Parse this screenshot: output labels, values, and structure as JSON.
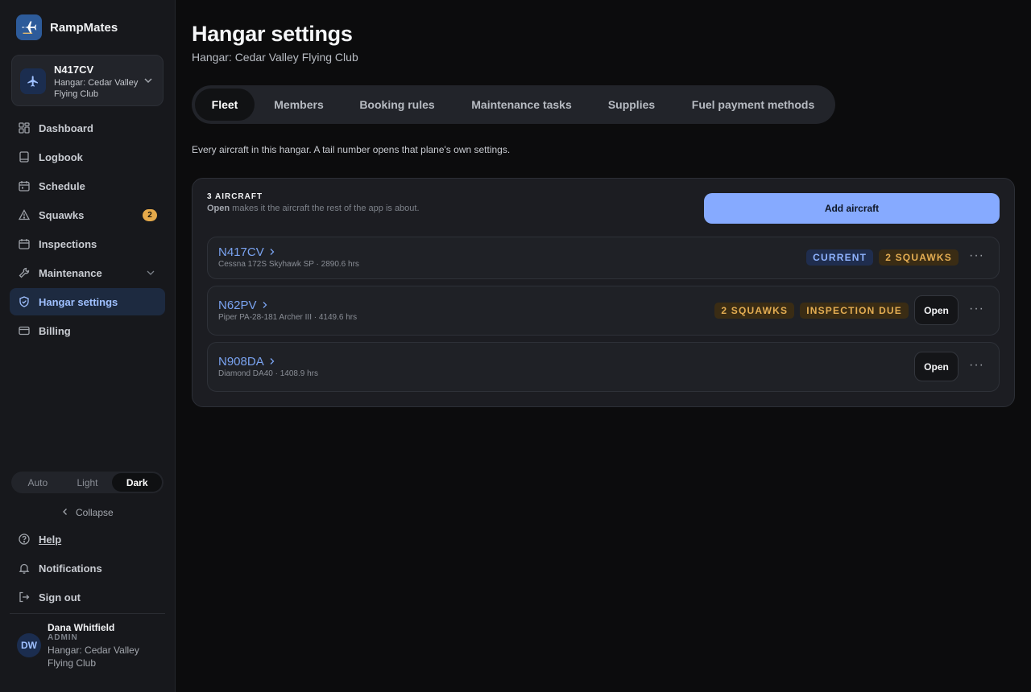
{
  "brand": {
    "name": "RampMates"
  },
  "account": {
    "tail": "N417CV",
    "hangar": "Hangar: Cedar Valley Flying Club"
  },
  "nav": {
    "items": [
      {
        "label": "Dashboard",
        "icon": "dashboard-icon"
      },
      {
        "label": "Logbook",
        "icon": "book-icon"
      },
      {
        "label": "Schedule",
        "icon": "calendar-icon"
      },
      {
        "label": "Squawks",
        "icon": "warning-icon",
        "badge": "2"
      },
      {
        "label": "Inspections",
        "icon": "calendar-check-icon"
      },
      {
        "label": "Maintenance",
        "icon": "wrench-icon"
      },
      {
        "label": "Hangar settings",
        "icon": "shield-icon",
        "active": true
      },
      {
        "label": "Billing",
        "icon": "card-icon"
      }
    ]
  },
  "theme": {
    "options": [
      "Auto",
      "Light",
      "Dark"
    ],
    "selected": "Dark"
  },
  "sidebar_footer": {
    "collapse": "Collapse",
    "help": "Help",
    "notifications": "Notifications",
    "signout": "Sign out"
  },
  "user": {
    "initials": "DW",
    "name": "Dana Whitfield",
    "role": "ADMIN",
    "hangar": "Hangar: Cedar Valley Flying Club"
  },
  "page": {
    "title": "Hangar settings",
    "subtitle": "Hangar: Cedar Valley Flying Club",
    "description": "Every aircraft in this hangar. A tail number opens that plane's own settings."
  },
  "tabs": [
    "Fleet",
    "Members",
    "Booking rules",
    "Maintenance tasks",
    "Supplies",
    "Fuel payment methods"
  ],
  "fleet": {
    "count_label": "3 AIRCRAFT",
    "help_bold": "Open",
    "help_rest": " makes it the aircraft the rest of the app is about.",
    "add_label": "Add aircraft",
    "open_label": "Open",
    "more_label": "···",
    "aircraft": [
      {
        "tail": "N417CV",
        "model": "Cessna 172S Skyhawk SP · 2890.6 hrs",
        "tags": [
          "CURRENT",
          "2 SQUAWKS"
        ]
      },
      {
        "tail": "N62PV",
        "model": "Piper PA-28-181 Archer III · 4149.6 hrs",
        "tags": [
          "2 SQUAWKS",
          "INSPECTION DUE"
        ]
      },
      {
        "tail": "N908DA",
        "model": "Diamond DA40 · 1408.9 hrs",
        "tags": []
      }
    ]
  },
  "colors": {
    "accent": "#86aaff",
    "warn": "#e4ad52",
    "tail": "#7aa3f0"
  }
}
